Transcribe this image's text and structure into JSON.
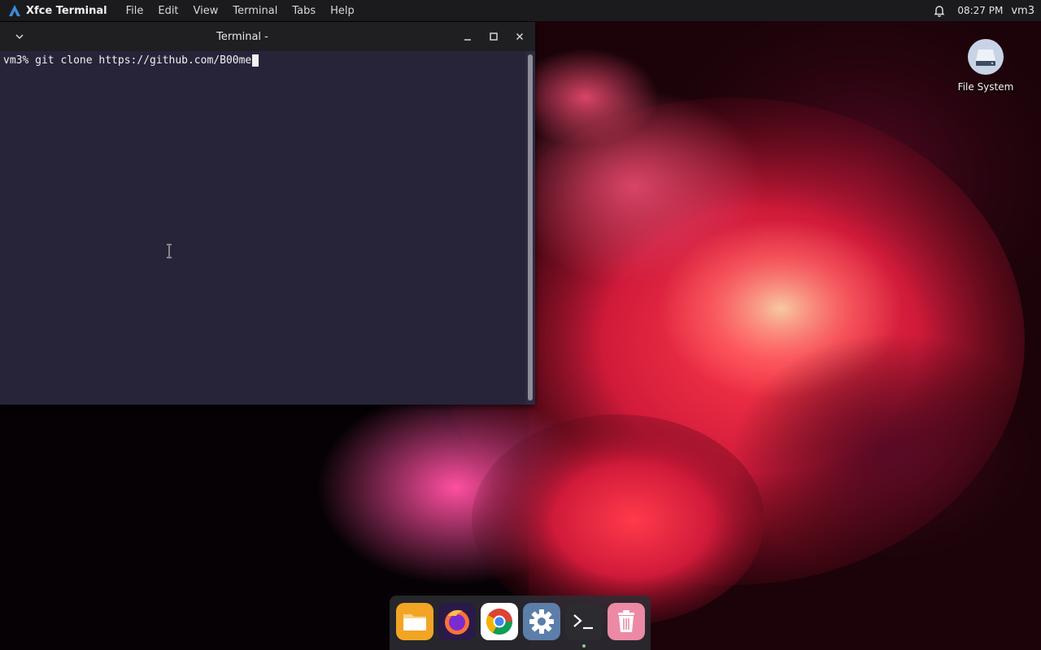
{
  "top_panel": {
    "app_name": "Xfce Terminal",
    "menu": [
      "File",
      "Edit",
      "View",
      "Terminal",
      "Tabs",
      "Help"
    ],
    "clock": "08:27 PM",
    "user": "vm3"
  },
  "terminal": {
    "title": "Terminal -",
    "prompt": "vm3% ",
    "command": "git clone https://github.com/B00me"
  },
  "desktop": {
    "icons": [
      {
        "label": "File System",
        "icon": "drive-icon"
      }
    ]
  },
  "dock": {
    "items": [
      {
        "name": "files",
        "icon": "folder-icon"
      },
      {
        "name": "firefox",
        "icon": "firefox-icon"
      },
      {
        "name": "chrome",
        "icon": "chrome-icon"
      },
      {
        "name": "settings",
        "icon": "gear-icon"
      },
      {
        "name": "terminal",
        "icon": "terminal-icon",
        "running": true
      },
      {
        "name": "trash",
        "icon": "trash-icon"
      }
    ]
  },
  "colors": {
    "terminal_bg": "#27243a",
    "titlebar_bg": "#1f1f22",
    "panel_bg": "#1b1b1d",
    "accent": "#3c8bd9"
  }
}
